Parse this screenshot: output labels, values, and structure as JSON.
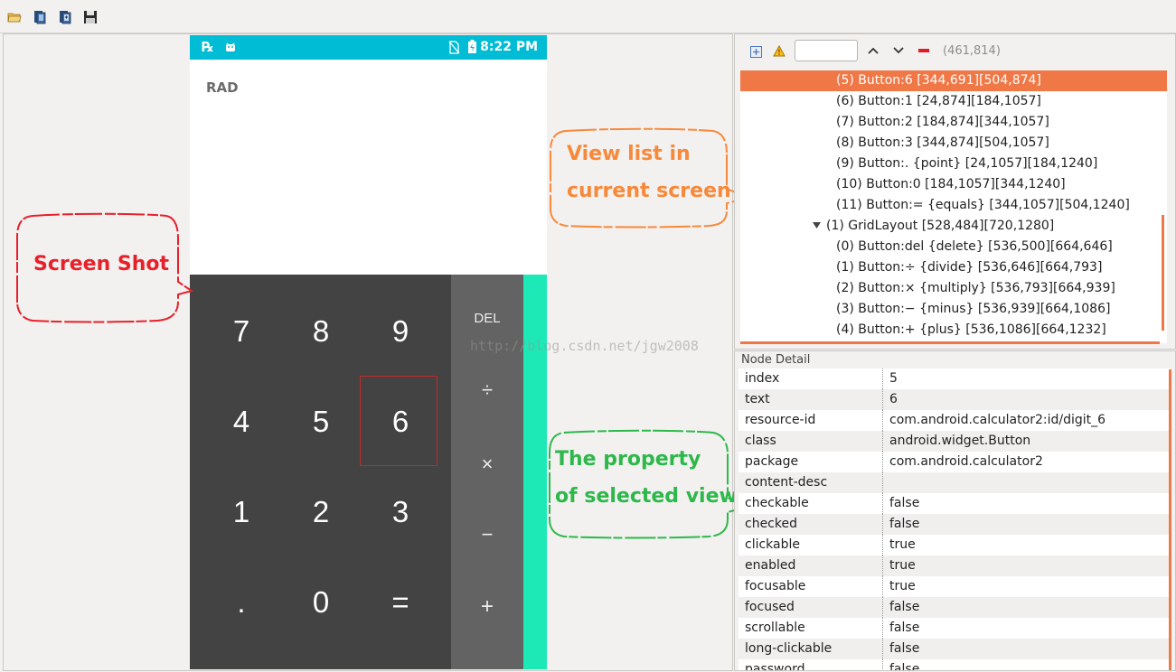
{
  "toolbar": {
    "buttons": [
      "open-folder-icon",
      "device-screenshot-icon",
      "device-screenshot-compressed-icon",
      "save-icon"
    ]
  },
  "phone": {
    "status_time": "8:22 PM",
    "display_label": "RAD",
    "keys": [
      "7",
      "8",
      "9",
      "4",
      "5",
      "6",
      "1",
      "2",
      "3",
      ".",
      "0",
      "="
    ],
    "ops": [
      "DEL",
      "÷",
      "×",
      "−",
      "+"
    ]
  },
  "watermark": "http://blog.csdn.net/jgw2008",
  "callouts": {
    "screenshot": "Screen Shot",
    "view_list_line1": "View list in",
    "view_list_line2": "current screen",
    "property_line1": "The property",
    "property_line2": "of selected view"
  },
  "colors": {
    "callout_red": "#e8202a",
    "callout_orange": "#f7893a",
    "callout_green": "#2db84a",
    "selection": "#f07746",
    "status_bar": "#00bcd4",
    "teal": "#1de9b6"
  },
  "tree": {
    "coords": "(461,814)",
    "search_value": "",
    "rows": [
      {
        "text": "(5) Button:6 [344,691][504,874]",
        "level": 2,
        "selected": true
      },
      {
        "text": "(6) Button:1 [24,874][184,1057]",
        "level": 2
      },
      {
        "text": "(7) Button:2 [184,874][344,1057]",
        "level": 2
      },
      {
        "text": "(8) Button:3 [344,874][504,1057]",
        "level": 2
      },
      {
        "text": "(9) Button:. {point} [24,1057][184,1240]",
        "level": 2
      },
      {
        "text": "(10) Button:0 [184,1057][344,1240]",
        "level": 2
      },
      {
        "text": "(11) Button:= {equals} [344,1057][504,1240]",
        "level": 2
      },
      {
        "text": "(1) GridLayout [528,484][720,1280]",
        "level": 1,
        "expanded": true
      },
      {
        "text": "(0) Button:del {delete} [536,500][664,646]",
        "level": 2
      },
      {
        "text": "(1) Button:÷ {divide} [536,646][664,793]",
        "level": 2
      },
      {
        "text": "(2) Button:× {multiply} [536,793][664,939]",
        "level": 2
      },
      {
        "text": "(3) Button:− {minus} [536,939][664,1086]",
        "level": 2
      },
      {
        "text": "(4) Button:+ {plus} [536,1086][664,1232]",
        "level": 2
      }
    ]
  },
  "detail": {
    "title": "Node Detail",
    "rows": [
      {
        "key": "index",
        "value": "5"
      },
      {
        "key": "text",
        "value": "6"
      },
      {
        "key": "resource-id",
        "value": "com.android.calculator2:id/digit_6"
      },
      {
        "key": "class",
        "value": "android.widget.Button"
      },
      {
        "key": "package",
        "value": "com.android.calculator2"
      },
      {
        "key": "content-desc",
        "value": ""
      },
      {
        "key": "checkable",
        "value": "false"
      },
      {
        "key": "checked",
        "value": "false"
      },
      {
        "key": "clickable",
        "value": "true"
      },
      {
        "key": "enabled",
        "value": "true"
      },
      {
        "key": "focusable",
        "value": "true"
      },
      {
        "key": "focused",
        "value": "false"
      },
      {
        "key": "scrollable",
        "value": "false"
      },
      {
        "key": "long-clickable",
        "value": "false"
      },
      {
        "key": "password",
        "value": "false"
      }
    ]
  }
}
